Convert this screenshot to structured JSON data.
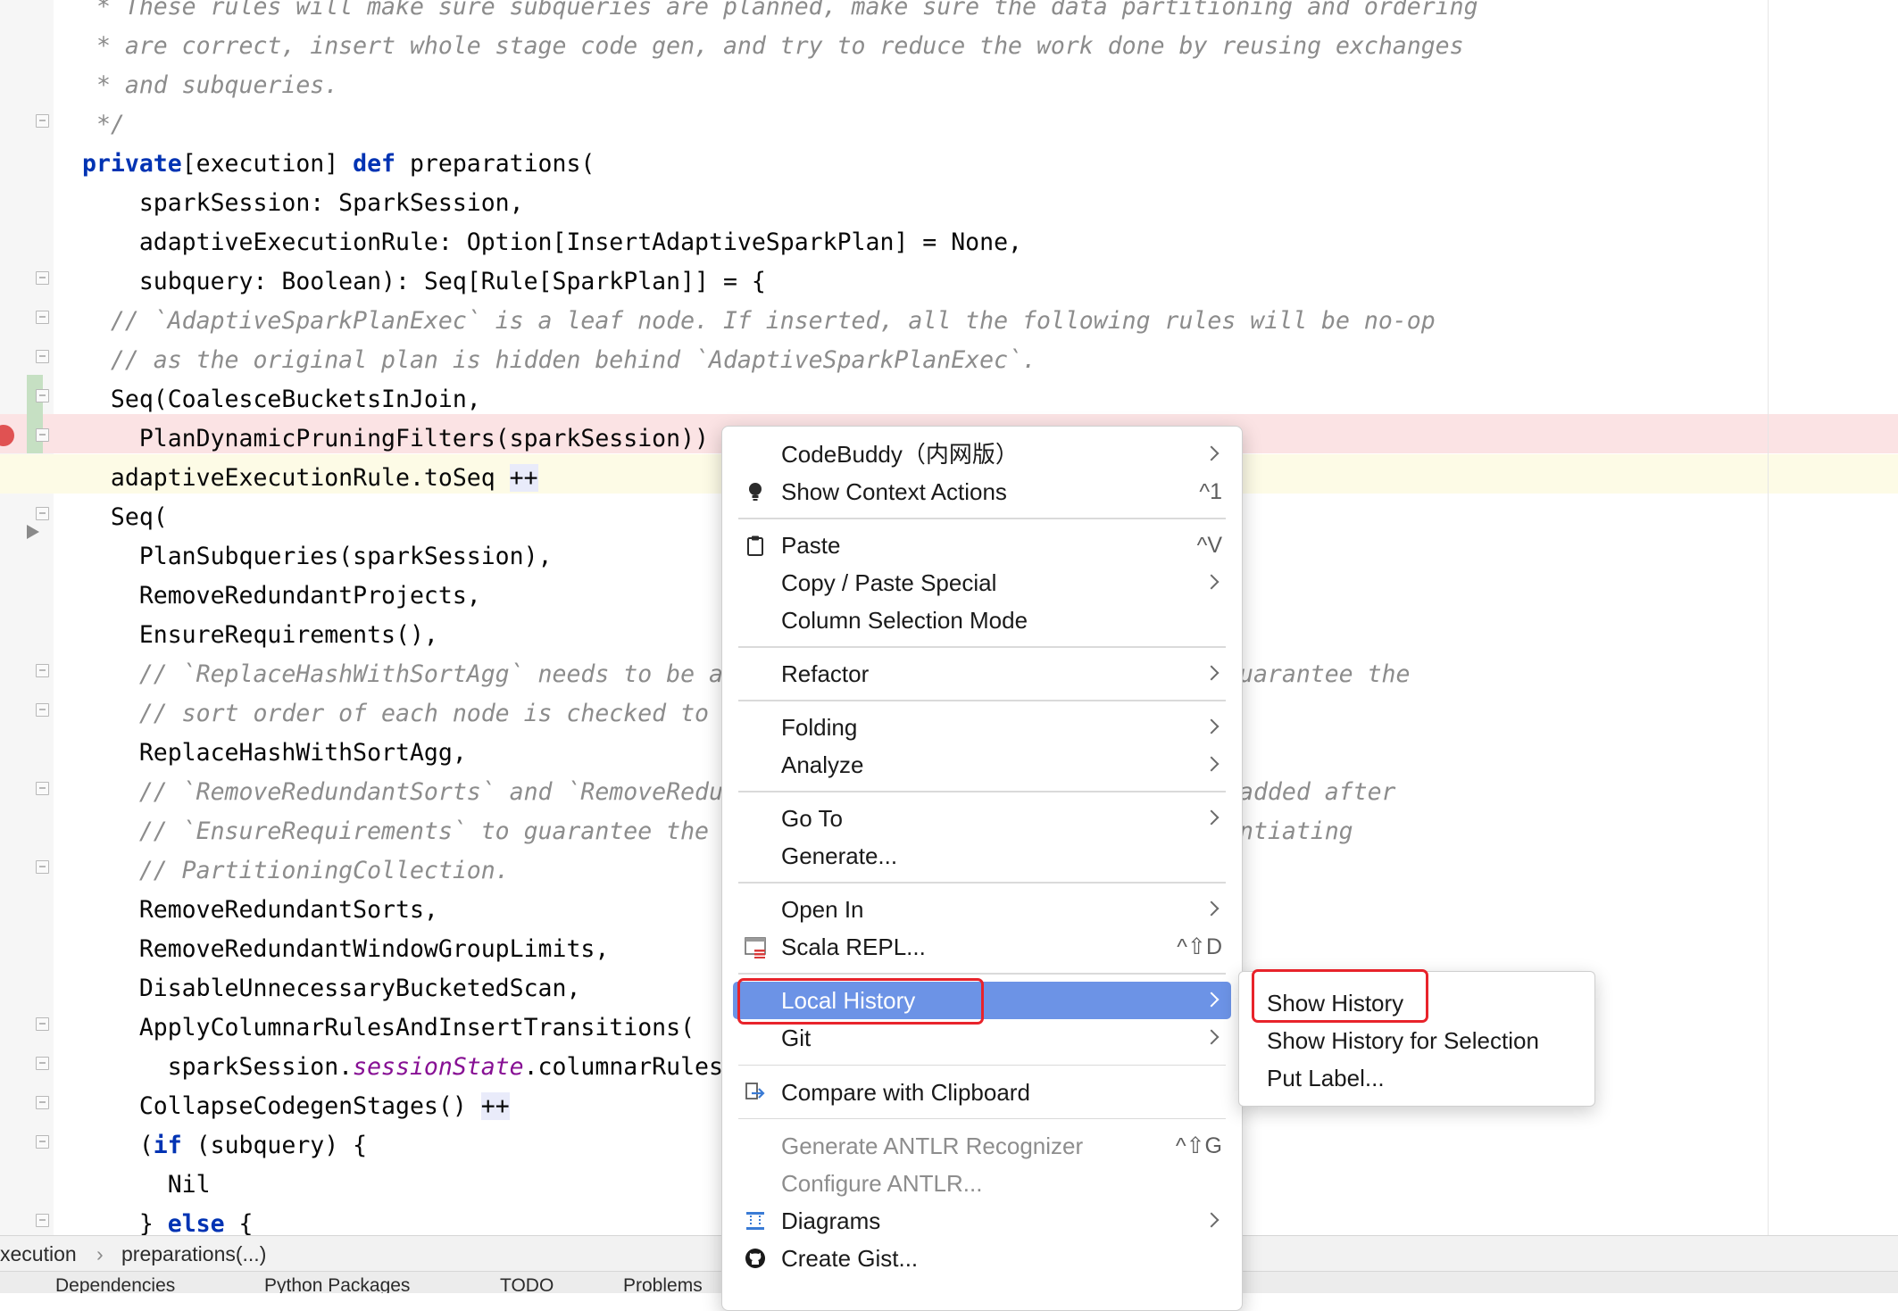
{
  "editor": {
    "lines": [
      {
        "text": " * These rules will make sure subqueries are planned, make sure the data partitioning and ordering",
        "kind": "comment"
      },
      {
        "text": " * are correct, insert whole stage code gen, and try to reduce the work done by reusing exchanges",
        "kind": "comment"
      },
      {
        "text": " * and subqueries.",
        "kind": "comment"
      },
      {
        "text": " */",
        "kind": "comment"
      },
      {
        "kw1": "private",
        "p1": "[execution] ",
        "kw2": "def",
        "p2": " preparations(",
        "kind": "decl"
      },
      {
        "text": "    sparkSession: SparkSession,",
        "kind": "code"
      },
      {
        "text": "    adaptiveExecutionRule: Option[InsertAdaptiveSparkPlan] = None,",
        "kind": "code"
      },
      {
        "text": "    subquery: Boolean): Seq[Rule[SparkPlan]] = {",
        "kind": "code"
      },
      {
        "text": "  // `AdaptiveSparkPlanExec` is a leaf node. If inserted, all the following rules will be no-op",
        "kind": "comment"
      },
      {
        "text": "  // as the original plan is hidden behind `AdaptiveSparkPlanExec`.",
        "kind": "comment"
      },
      {
        "text": "  Seq(CoalesceBucketsInJoin,",
        "kind": "code"
      },
      {
        "text": "    PlanDynamicPruningFilters(sparkSession))",
        "kind": "code"
      },
      {
        "text": "  adaptiveExecutionRule.toSeq ",
        "pp": "++",
        "kind": "pp"
      },
      {
        "text": "  Seq(",
        "kind": "code"
      },
      {
        "text": "    PlanSubqueries(sparkSession),",
        "kind": "code"
      },
      {
        "text": "    RemoveRedundantProjects,",
        "kind": "code"
      },
      {
        "text": "    EnsureRequirements(),",
        "kind": "code"
      },
      {
        "text": "    // `ReplaceHashWithSortAgg` needs to be a",
        "tail": "uarantee the",
        "kind": "comment-split"
      },
      {
        "text": "    // sort order of each node is checked to",
        "kind": "comment"
      },
      {
        "text": "    ReplaceHashWithSortAgg,",
        "kind": "code"
      },
      {
        "text": "    // `RemoveRedundantSorts` and `RemoveRedu",
        "tail": "added after",
        "kind": "comment-split"
      },
      {
        "text": "    // `EnsureRequirements` to guarantee the",
        "tail": "ntiating",
        "kind": "comment-split"
      },
      {
        "text": "    // PartitioningCollection.",
        "kind": "comment"
      },
      {
        "text": "    RemoveRedundantSorts,",
        "kind": "code"
      },
      {
        "text": "    RemoveRedundantWindowGroupLimits,",
        "kind": "code"
      },
      {
        "text": "    DisableUnnecessaryBucketedScan,",
        "kind": "code"
      },
      {
        "text": "    ApplyColumnarRulesAndInsertTransitions(",
        "kind": "code"
      },
      {
        "p1": "      sparkSession.",
        "field": "sessionState",
        "p2": ".columnarRules",
        "kind": "field"
      },
      {
        "text": "    CollapseCodegenStages() ",
        "pp": "++",
        "kind": "pp"
      },
      {
        "p0": "    (",
        "kw1": "if",
        "p1": " (subquery) {",
        "kind": "if"
      },
      {
        "text": "      Nil",
        "kind": "code"
      },
      {
        "p0": "    } ",
        "kw1": "else",
        "p1": " {",
        "kind": "if"
      }
    ]
  },
  "breadcrumb": {
    "item1": "xecution",
    "item2": "preparations(...)"
  },
  "tool_tabs": [
    "Dependencies",
    "Python Packages",
    "TODO",
    "Problems"
  ],
  "context_menu": {
    "items": [
      {
        "label": "CodeBuddy（内网版）",
        "submenu": true
      },
      {
        "label": "Show Context Actions",
        "shortcut": "^1",
        "icon": "lightbulb-icon"
      },
      {
        "sep": true
      },
      {
        "label": "Paste",
        "shortcut": "^V",
        "icon": "clipboard-icon"
      },
      {
        "label": "Copy / Paste Special",
        "submenu": true
      },
      {
        "label": "Column Selection Mode"
      },
      {
        "sep": true
      },
      {
        "label": "Refactor",
        "submenu": true
      },
      {
        "sep": true
      },
      {
        "label": "Folding",
        "submenu": true
      },
      {
        "label": "Analyze",
        "submenu": true
      },
      {
        "sep": true
      },
      {
        "label": "Go To",
        "submenu": true
      },
      {
        "label": "Generate..."
      },
      {
        "sep": true
      },
      {
        "label": "Open In",
        "submenu": true
      },
      {
        "label": "Scala REPL...",
        "shortcut": "^⇧D",
        "icon": "scala-repl-icon"
      },
      {
        "sep": true
      },
      {
        "label": "Local History",
        "submenu": true,
        "selected": true
      },
      {
        "label": "Git",
        "submenu": true
      },
      {
        "sep": true
      },
      {
        "label": "Compare with Clipboard",
        "icon": "compare-icon"
      },
      {
        "sep": true
      },
      {
        "label": "Generate ANTLR Recognizer",
        "shortcut": "^⇧G",
        "disabled": true
      },
      {
        "label": "Configure ANTLR...",
        "disabled": true
      },
      {
        "label": "Diagrams",
        "submenu": true,
        "icon": "diagram-icon"
      },
      {
        "label": "Create Gist...",
        "icon": "github-icon"
      }
    ]
  },
  "submenu": {
    "items": [
      "Show History",
      "Show History for Selection",
      "Put Label..."
    ]
  },
  "colors": {
    "selection": "#6c93e6",
    "highlight_box": "#e8232b",
    "keyword": "#0033b3",
    "comment": "#8c8c8c"
  }
}
